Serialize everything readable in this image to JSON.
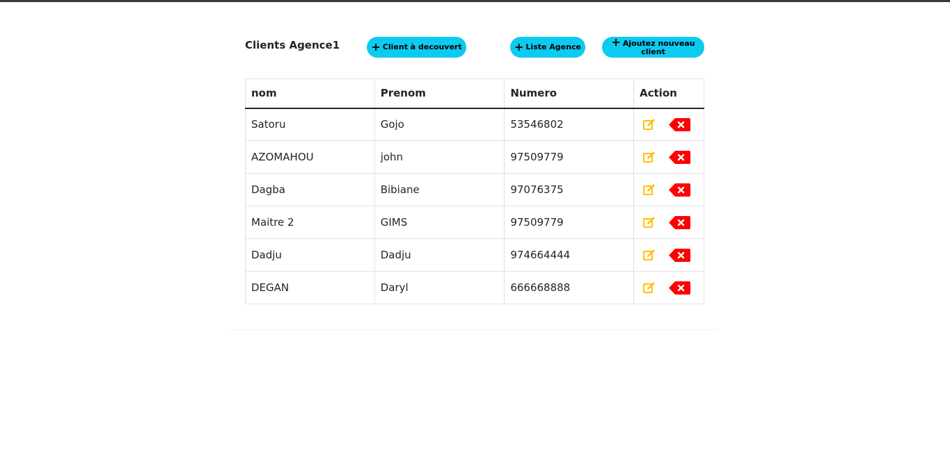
{
  "header": {
    "title": "Clients Agence1",
    "buttons": {
      "client_discover": "Client à decouvert",
      "agency_list": "Liste Agence",
      "add_client": "Ajoutez nouveau client"
    }
  },
  "table": {
    "columns": [
      "nom",
      "Prenom",
      "Numero",
      "Action"
    ],
    "rows": [
      {
        "nom": "Satoru",
        "prenom": "Gojo",
        "numero": "53546802"
      },
      {
        "nom": "AZOMAHOU",
        "prenom": "john",
        "numero": "97509779"
      },
      {
        "nom": "Dagba",
        "prenom": "Bibiane",
        "numero": "97076375"
      },
      {
        "nom": "Maitre 2",
        "prenom": "GIMS",
        "numero": "97509779"
      },
      {
        "nom": "Dadju",
        "prenom": "Dadju",
        "numero": "974664444"
      },
      {
        "nom": "DEGAN",
        "prenom": "Daryl",
        "numero": "666668888"
      }
    ]
  },
  "icons": {
    "plus": "plus-icon",
    "edit": "edit-icon",
    "delete": "delete-icon"
  },
  "colors": {
    "button_bg": "#0dcaf0",
    "edit": "#ffc107",
    "delete": "#ff0000",
    "topbar": "#343a40"
  }
}
